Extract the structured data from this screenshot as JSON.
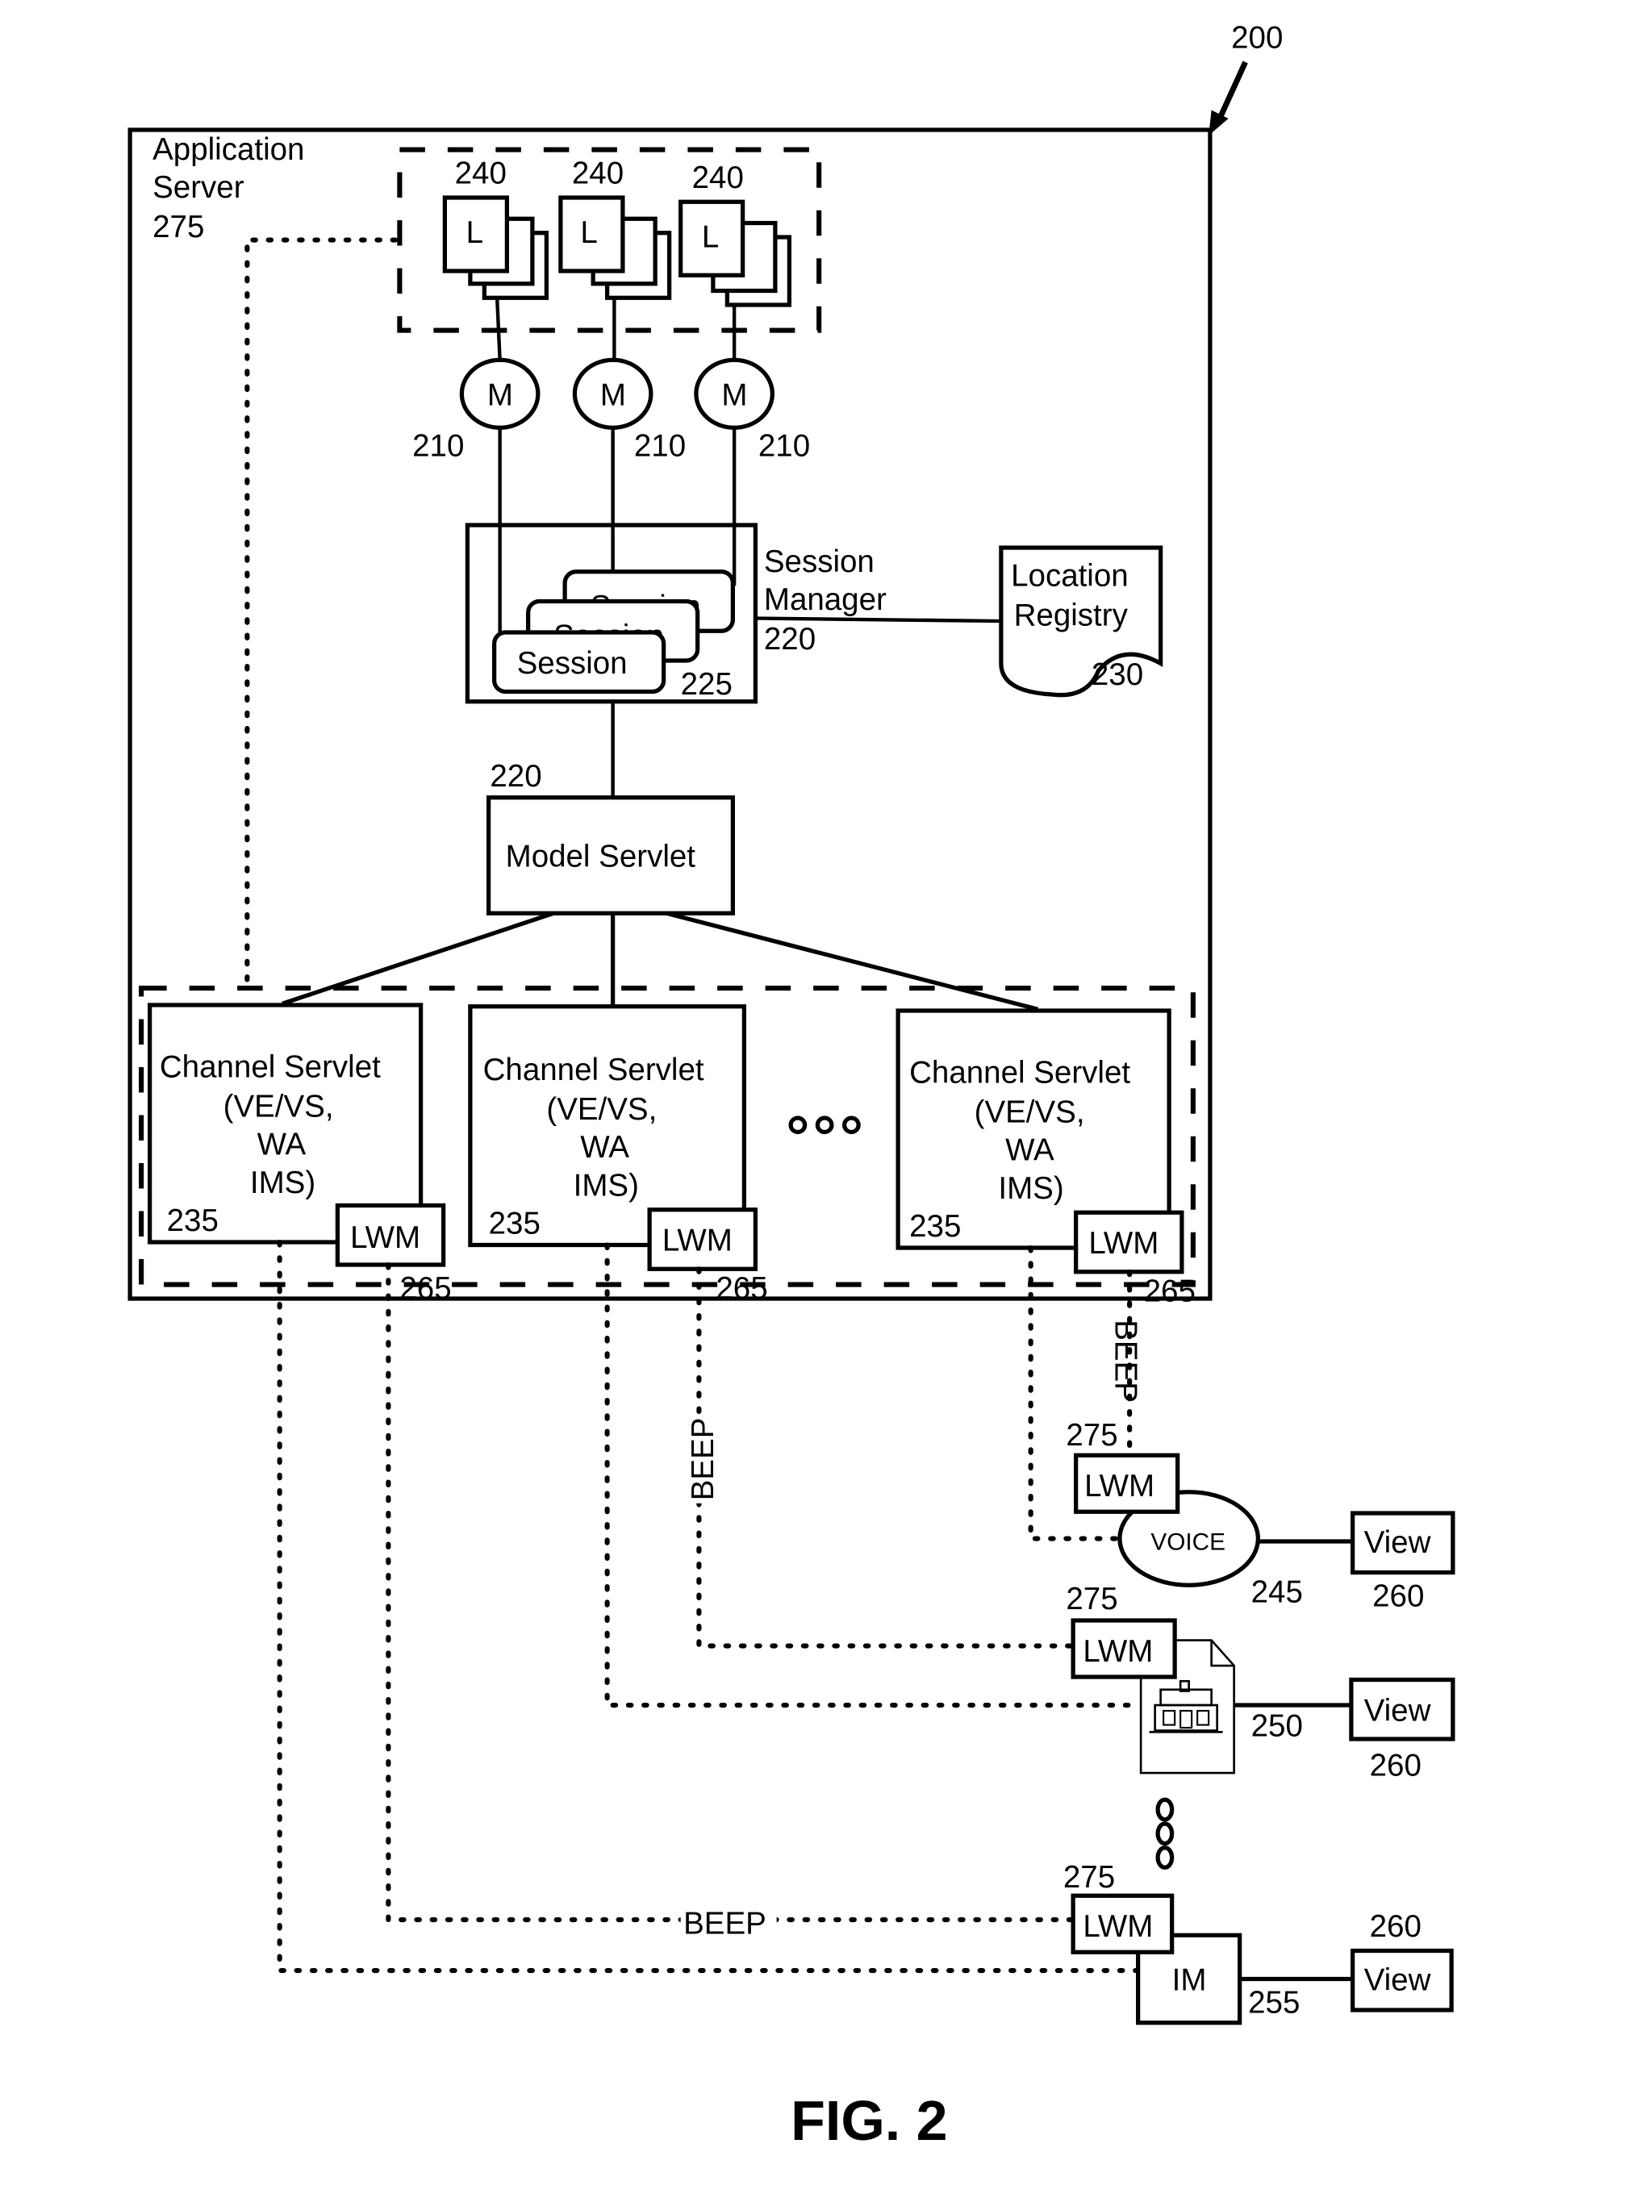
{
  "figure": {
    "ref_main": "200",
    "caption": "FIG. 2"
  },
  "app_server": {
    "label_line1": "Application",
    "label_line2": "Server",
    "ref": "275"
  },
  "listeners": {
    "glyph": "L",
    "refs": [
      "240",
      "240",
      "240"
    ]
  },
  "models": {
    "glyph": "M",
    "refs": [
      "210",
      "210",
      "210"
    ]
  },
  "session_manager": {
    "label_line1": "Session",
    "label_line2": "Manager",
    "ref": "220",
    "session_label": "Session",
    "session_ref": "225"
  },
  "location_registry": {
    "label_line1": "Location",
    "label_line2": "Registry",
    "ref": "230"
  },
  "model_servlet": {
    "label": "Model Servlet",
    "ref": "220"
  },
  "channel_servlets": {
    "items": [
      {
        "line1": "Channel Servlet",
        "line2": "(VE/VS,",
        "line3": "WA",
        "line4": "IMS)",
        "ref": "235",
        "lwm": "LWM",
        "lwm_ref": "265"
      },
      {
        "line1": "Channel Servlet",
        "line2": "(VE/VS,",
        "line3": "WA",
        "line4": "IMS)",
        "ref": "235",
        "lwm": "LWM",
        "lwm_ref": "265"
      },
      {
        "line1": "Channel Servlet",
        "line2": "(VE/VS,",
        "line3": "WA",
        "line4": "IMS)",
        "ref": "235",
        "lwm": "LWM",
        "lwm_ref": "265"
      }
    ],
    "ellipsis_icon": "horizontal-ellipsis"
  },
  "connections": {
    "beep_label": "BEEP"
  },
  "clients": {
    "voice": {
      "label": "VOICE",
      "ref": "245",
      "lwm": "LWM",
      "lwm_ref": "275",
      "view": "View",
      "view_ref": "260"
    },
    "web": {
      "icon": "web-page-house-icon",
      "ref": "250",
      "lwm": "LWM",
      "lwm_ref": "275",
      "view": "View",
      "view_ref": "260"
    },
    "im": {
      "label": "IM",
      "ref": "255",
      "lwm": "LWM",
      "lwm_ref": "275",
      "view": "View",
      "view_ref": "260"
    },
    "ellipsis_icon": "vertical-ellipsis"
  }
}
